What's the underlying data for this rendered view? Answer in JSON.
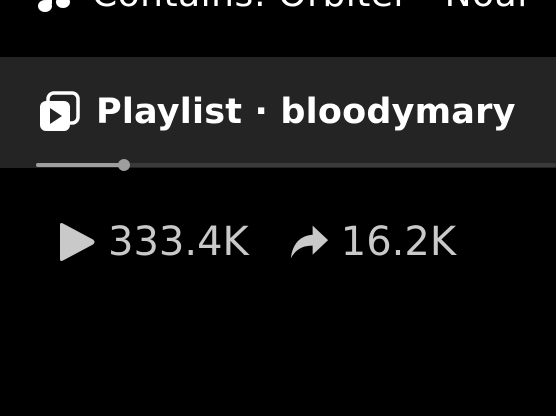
{
  "header": {
    "contains_text": "Contains: Orbiter · Noal",
    "music_icon": "music-note-icon"
  },
  "playlist": {
    "icon": "playlist-icon",
    "label": "Playlist · bloodymary",
    "progress": 0.17
  },
  "stats": {
    "plays": {
      "icon": "play-icon",
      "value": "333.4K"
    },
    "shares": {
      "icon": "share-icon",
      "value": "16.2K"
    }
  },
  "colors": {
    "background": "#000000",
    "bar": "#242424",
    "text_primary": "#ffffff",
    "text_secondary": "#c9c9c9",
    "progress": "#9e9e9e"
  }
}
